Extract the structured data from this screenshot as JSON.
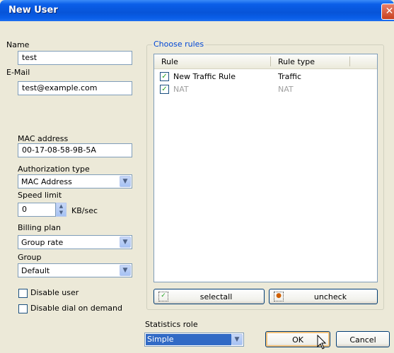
{
  "window": {
    "title": "New User"
  },
  "form": {
    "name_label": "Name",
    "name_value": "test",
    "email_label": "E-Mail",
    "email_value": "test@example.com",
    "mac_label": "MAC address",
    "mac_value": "00-17-08-58-9B-5A",
    "auth_label": "Authorization type",
    "auth_value": "MAC Address",
    "speed_label": "Speed limit",
    "speed_value": "0",
    "speed_unit": "KB/sec",
    "billing_label": "Billing plan",
    "billing_value": "Group rate",
    "group_label": "Group",
    "group_value": "Default",
    "disable_user_label": "Disable user",
    "disable_dial_label": "Disable dial on demand",
    "stats_label": "Statistics role",
    "stats_value": "Simple"
  },
  "rules": {
    "group_title": "Choose rules",
    "columns": [
      "Rule",
      "Rule type"
    ],
    "rows": [
      {
        "rule": "New Traffic Rule",
        "type": "Traffic",
        "checked": true,
        "enabled": true
      },
      {
        "rule": "NAT",
        "type": "NAT",
        "checked": true,
        "enabled": false
      }
    ],
    "selectall_label": "selectall",
    "uncheck_label": "uncheck"
  },
  "buttons": {
    "ok": "OK",
    "cancel": "Cancel"
  },
  "colors": {
    "titlebar": "#0754d8",
    "accent": "#0046d5",
    "selection": "#316ac5"
  }
}
